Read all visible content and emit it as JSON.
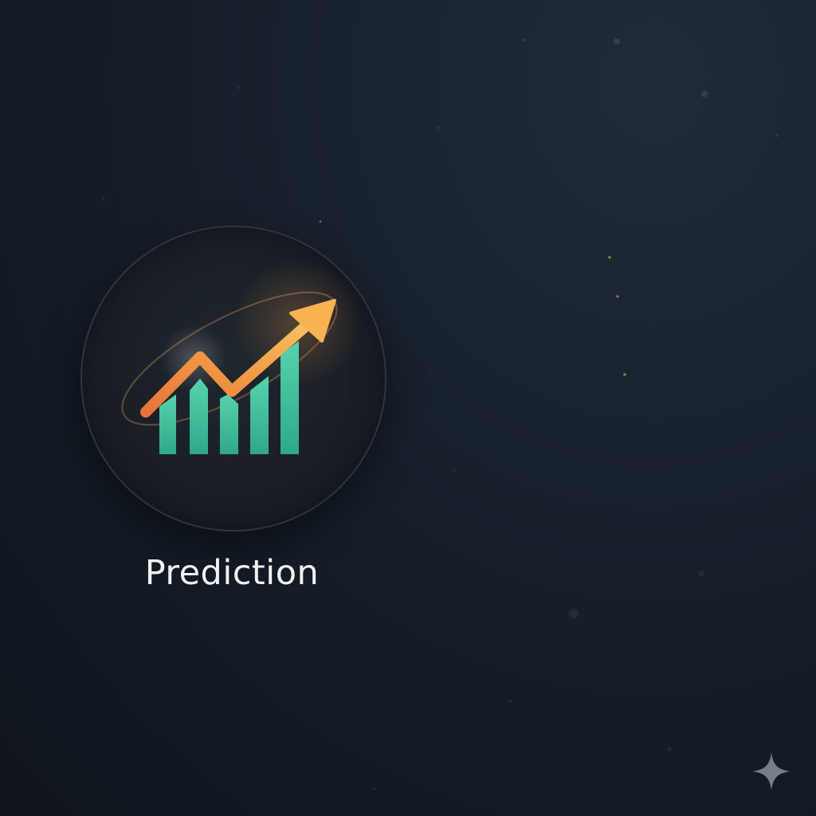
{
  "tile": {
    "label": "Prediction",
    "icon": "chart-growth-icon"
  },
  "colors": {
    "background": "#161e29",
    "bars": "#3fbf9a",
    "arrow": "#f0a040",
    "text": "#f1f1f1",
    "sparkle": "#9aa0a8"
  },
  "corner_icon": "sparkle-icon"
}
